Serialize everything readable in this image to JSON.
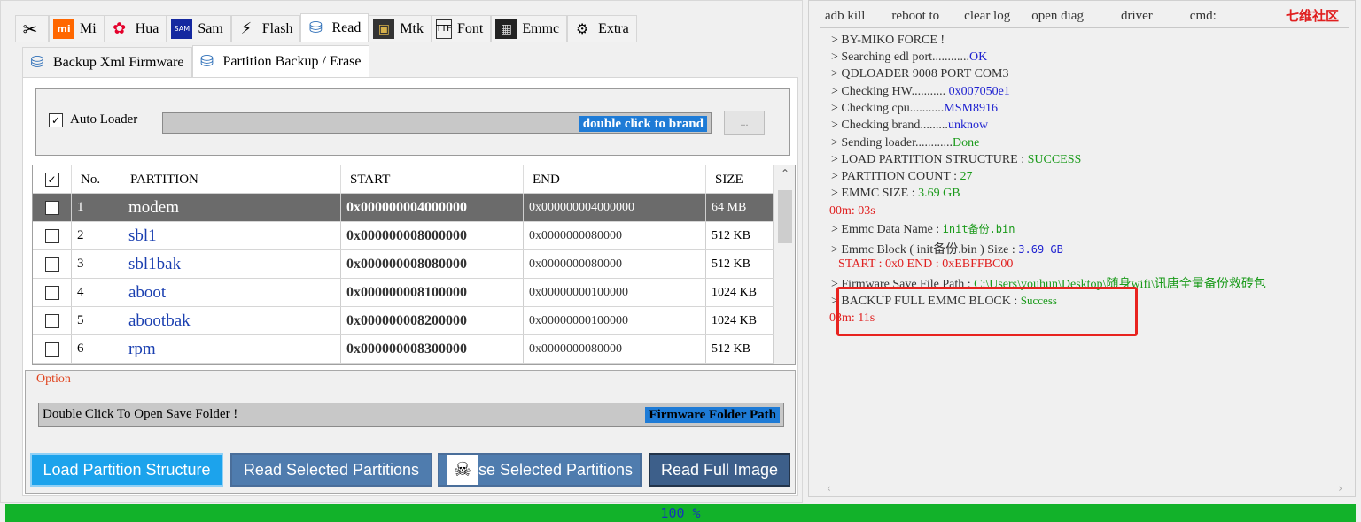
{
  "tabs": [
    {
      "label": "",
      "icon": "tools-icon",
      "glyph": "✂"
    },
    {
      "label": "Mi",
      "icon": "xiaomi-icon",
      "glyph": "mi"
    },
    {
      "label": "Hua",
      "icon": "huawei-icon",
      "glyph": "✿"
    },
    {
      "label": "Sam",
      "icon": "samsung-icon",
      "glyph": "▬"
    },
    {
      "label": "Flash",
      "icon": "lightning-icon",
      "glyph": "⚡"
    },
    {
      "label": "Read",
      "icon": "read-database-icon",
      "glyph": "⛁"
    },
    {
      "label": "Mtk",
      "icon": "chip-icon",
      "glyph": "▣"
    },
    {
      "label": "Font",
      "icon": "font-icon",
      "glyph": "🗎"
    },
    {
      "label": "Emmc",
      "icon": "emmc-icon",
      "glyph": "▦"
    },
    {
      "label": "Extra",
      "icon": "extra-icon",
      "glyph": "⚙"
    }
  ],
  "active_tab": "Read",
  "subtabs": [
    {
      "label": "Backup Xml Firmware",
      "icon": "xml-firmware-icon"
    },
    {
      "label": "Partition Backup / Erase",
      "icon": "partition-icon"
    }
  ],
  "auto_loader": {
    "label": "Auto Loader",
    "checked": true
  },
  "brand_field": {
    "text": "double click to brand"
  },
  "dots_button": {
    "label": "..."
  },
  "table": {
    "headers": [
      "No.",
      "PARTITION",
      "START",
      "END",
      "SIZE"
    ],
    "rows": [
      {
        "no": "1",
        "name": "modem",
        "start": "0x000000004000000",
        "end": "0x000000004000000",
        "size": "64 MB",
        "selected": true
      },
      {
        "no": "2",
        "name": "sbl1",
        "start": "0x000000008000000",
        "end": "0x0000000080000",
        "size": "512 KB",
        "selected": false
      },
      {
        "no": "3",
        "name": "sbl1bak",
        "start": "0x000000008080000",
        "end": "0x0000000080000",
        "size": "512 KB",
        "selected": false
      },
      {
        "no": "4",
        "name": "aboot",
        "start": "0x000000008100000",
        "end": "0x00000000100000",
        "size": "1024 KB",
        "selected": false
      },
      {
        "no": "5",
        "name": "abootbak",
        "start": "0x000000008200000",
        "end": "0x00000000100000",
        "size": "1024 KB",
        "selected": false
      },
      {
        "no": "6",
        "name": "rpm",
        "start": "0x000000008300000",
        "end": "0x0000000080000",
        "size": "512 KB",
        "selected": false
      }
    ]
  },
  "option": {
    "label": "Option",
    "folder_text": "Double Click To Open Save Folder !",
    "folder_path": "Firmware Folder Path"
  },
  "buttons": {
    "load": "Load Partition Structure",
    "read_selected": "Read Selected Partitions",
    "erase_selected": "se Selected Partitions",
    "read_full": "Read Full Image"
  },
  "menu": [
    "adb kill",
    "reboot to",
    "clear log",
    "open diag",
    "driver",
    "cmd:"
  ],
  "brand_watermark": "七维社区",
  "log": {
    "l1": "> BY-MIKO FORCE !",
    "l2a": "> Searching edl port............",
    "l2b": "OK",
    "l3": "> QDLOADER 9008 PORT COM3",
    "l4a": "> Checking HW........... ",
    "l4b": "0x007050e1",
    "l5a": "> Checking cpu...........",
    "l5b": "MSM8916",
    "l6a": "> Checking brand.........",
    "l6b": "unknow",
    "l7a": "> Sending loader............",
    "l7b": "Done",
    "l8a": "> LOAD PARTITION  STRUCTURE  :  ",
    "l8b": "SUCCESS",
    "l9a": "> PARTITION COUNT  : ",
    "l9b": "27",
    "l10a": "> EMMC SIZE  :  ",
    "l10b": "3.69 GB",
    "l11": "00m: 03s",
    "l12a": "> Emmc Data Name  :  ",
    "l12b": "init备份.bin",
    "l13a": "> Emmc Block ( init备份.bin )  Size    :  ",
    "l13b": "3.69 GB",
    "l14a": "START  :  0x0    END :  ",
    "l14b": "0xEBFFBC00",
    "l15a": "> Firmware Save File  Path : ",
    "l15b": "C:\\Users\\youhun\\Desktop\\随身wifi\\讯唐全量备份救砖包",
    "l16a": "> BACKUP FULL EMMC BLOCK   :  ",
    "l16b": "Success",
    "l17": "03m: 11s"
  },
  "progress": {
    "value": 100,
    "text": "100 %"
  },
  "colors": {
    "progress": "#12b22a",
    "accent_blue": "#1e7bd6",
    "log_red": "#e02020",
    "log_green": "#1a9a1a",
    "log_blue": "#1f22d0"
  }
}
